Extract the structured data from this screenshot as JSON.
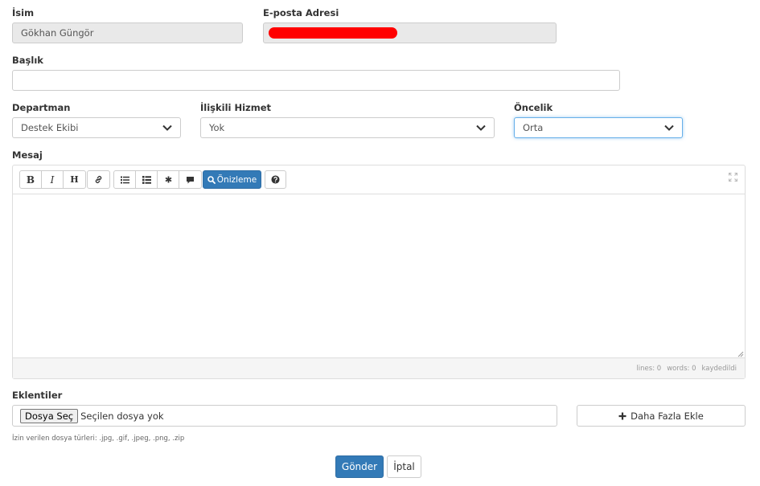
{
  "form": {
    "name_label": "İsim",
    "name_value": "Gökhan Güngör",
    "email_label": "E-posta Adresi",
    "subject_label": "Başlık",
    "subject_value": "",
    "department_label": "Departman",
    "department_value": "Destek Ekibi",
    "service_label": "İlişkili Hizmet",
    "service_value": "Yok",
    "priority_label": "Öncelik",
    "priority_value": "Orta",
    "message_label": "Mesaj"
  },
  "editor": {
    "bold": "B",
    "italic": "I",
    "heading": "H",
    "preview_label": "Önizleme",
    "status_lines": "lines: 0",
    "status_words": "words: 0",
    "status_saved": "kaydedildi"
  },
  "attachments": {
    "label": "Eklentiler",
    "choose_button": "Dosya Seç",
    "no_file": "Seçilen dosya yok",
    "add_more": "Daha Fazla Ekle",
    "allowed_types": "İzin verilen dosya türleri: .jpg, .gif, .jpeg, .png, .zip"
  },
  "actions": {
    "submit": "Gönder",
    "cancel": "İptal"
  },
  "colors": {
    "primary": "#337ab7",
    "redaction": "#ff0000"
  },
  "icons": [
    "link-icon",
    "unordered-list-icon",
    "ordered-list-icon",
    "asterisk-icon",
    "comment-icon",
    "search-icon",
    "question-icon",
    "expand-icon",
    "plus-icon",
    "chevron-down-icon",
    "resize-grip-icon"
  ]
}
